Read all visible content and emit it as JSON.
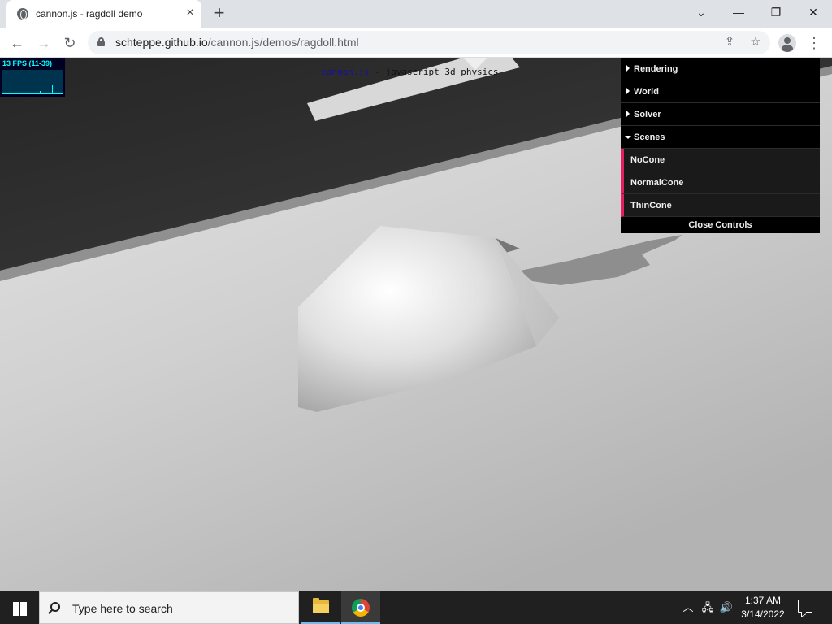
{
  "browser": {
    "tab": {
      "title": "cannon.js - ragdoll demo",
      "favicon": "globe-icon"
    },
    "new_tab_label": "+",
    "window_controls": {
      "tab_search": "⌄",
      "minimize": "—",
      "restore": "❐",
      "close": "✕"
    },
    "address": {
      "host": "schteppe.github.io",
      "path": "/cannon.js/demos/ragdoll.html"
    },
    "icons": {
      "back": "←",
      "forward": "→",
      "reload": "↻",
      "share": "⇪",
      "star": "☆",
      "menu": "⋮"
    }
  },
  "page": {
    "stats": {
      "fps_text": "13 FPS (11-39)",
      "graph": [
        0,
        0,
        0,
        0,
        0,
        0,
        0,
        0,
        0,
        0,
        0,
        0,
        0,
        0,
        0,
        0,
        0,
        0,
        0,
        0,
        0,
        0,
        0,
        0,
        0,
        0,
        0,
        0,
        0,
        0,
        0,
        0,
        0,
        0,
        0,
        0,
        0,
        0,
        0,
        0,
        0,
        0,
        0,
        0,
        0,
        0,
        0,
        0,
        0,
        0,
        0,
        0,
        0,
        0,
        0,
        0,
        0,
        0,
        0,
        0,
        0,
        0,
        0,
        0,
        0,
        0,
        0,
        0,
        0,
        0,
        0,
        0,
        0,
        0
      ]
    },
    "info": {
      "link_text": "cannon.js",
      "rest": " - javascript 3d physics"
    },
    "gui": {
      "folders": [
        {
          "label": "Rendering",
          "open": false
        },
        {
          "label": "World",
          "open": false
        },
        {
          "label": "Solver",
          "open": false
        },
        {
          "label": "Scenes",
          "open": true
        }
      ],
      "scene_items": [
        "NoCone",
        "NormalCone",
        "ThinCone"
      ],
      "close_label": "Close Controls",
      "accent_color": "#e61d5f"
    }
  },
  "taskbar": {
    "search_placeholder": "Type here to search",
    "apps": [
      {
        "name": "file-explorer-icon"
      },
      {
        "name": "chrome-icon",
        "active": true
      }
    ],
    "tray": {
      "chevron": "︿",
      "network": "🖧",
      "volume": "🔊"
    },
    "time": "1:37 AM",
    "date": "3/14/2022"
  }
}
